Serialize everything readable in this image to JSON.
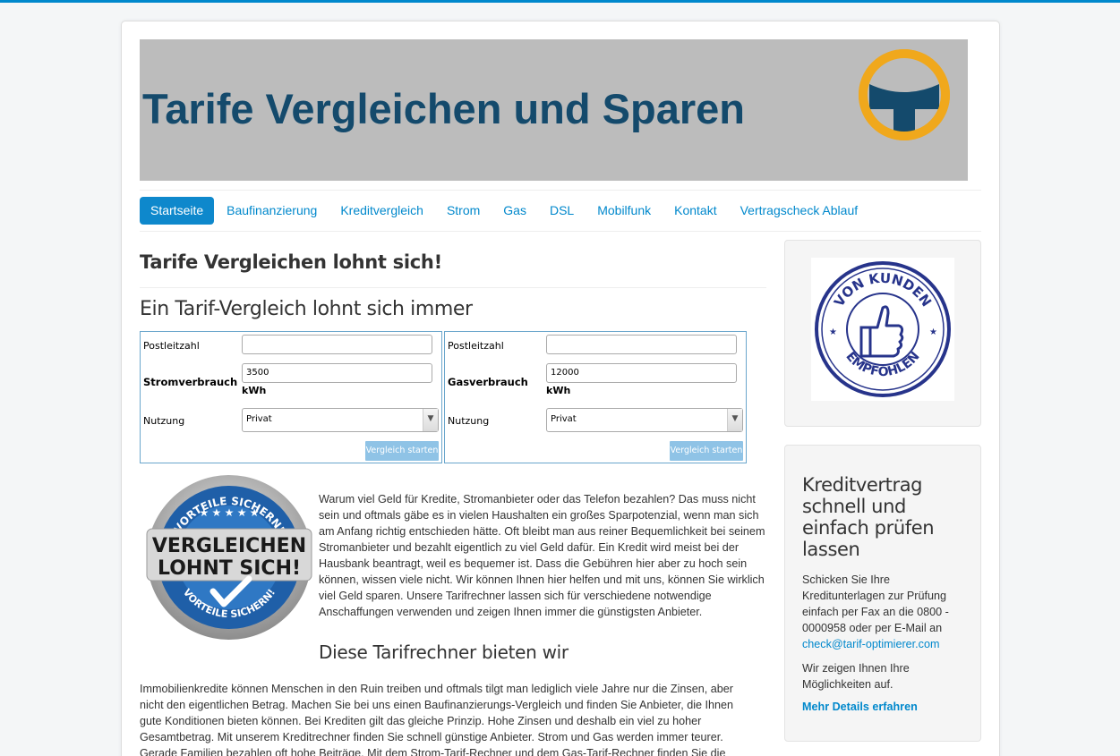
{
  "site": {
    "header_title": "Tarife Vergleichen und Sparen"
  },
  "nav": [
    {
      "label": "Startseite"
    },
    {
      "label": "Baufinanzierung"
    },
    {
      "label": "Kreditvergleich"
    },
    {
      "label": "Strom"
    },
    {
      "label": "Gas"
    },
    {
      "label": "DSL"
    },
    {
      "label": "Mobilfunk"
    },
    {
      "label": "Kontakt"
    },
    {
      "label": "Vertragscheck Ablauf"
    }
  ],
  "main": {
    "heading": "Tarife Vergleichen lohnt sich!",
    "subheading": "Ein Tarif-Vergleich lohnt sich immer",
    "strom_calc": {
      "plz_label": "Postleitzahl",
      "plz_value": "",
      "consumption_label": "Stromverbrauch",
      "consumption_value": "3500",
      "unit": "kWh",
      "usage_label": "Nutzung",
      "usage_value": "Privat",
      "button": "Vergleich starten"
    },
    "gas_calc": {
      "plz_label": "Postleitzahl",
      "plz_value": "",
      "consumption_label": "Gasverbrauch",
      "consumption_value": "12000",
      "unit": "kWh",
      "usage_label": "Nutzung",
      "usage_value": "Privat",
      "button": "Vergleich starten"
    },
    "badge": {
      "top_arc": "VORTEILE SICHERN!",
      "line1": "VERGLEICHEN",
      "line2": "LOHNT SICH!",
      "bottom_arc": "VORTEILE SICHERN!"
    },
    "intro": "Warum viel Geld für Kredite, Stromanbieter oder das Telefon bezahlen? Das muss nicht sein und oftmals gäbe es in vielen Haushalten ein großes Sparpotenzial, wenn man sich am Anfang richtig entschieden hätte. Oft bleibt man aus reiner Bequemlichkeit bei seinem Stromanbieter und bezahlt eigentlich zu viel Geld dafür. Ein Kredit wird meist bei der Hausbank beantragt, weil es bequemer ist. Dass die Gebühren hier aber zu hoch sein können, wissen viele nicht. Wir können Ihnen hier helfen und mit uns, können Sie wirklich viel Geld sparen. Unsere Tarifrechner lassen sich für verschiedene notwendige Anschaffungen verwenden und zeigen Ihnen immer die günstigsten Anbieter.",
    "offer_heading": "Diese Tarifrechner bieten wir",
    "body": "Immobilienkredite können Menschen in den Ruin treiben und oftmals tilgt man lediglich viele Jahre nur die Zinsen, aber nicht den eigentlichen Betrag. Machen Sie bei uns einen Baufinanzierungs-Vergleich und finden Sie Anbieter, die Ihnen gute Konditionen bieten können. Bei Krediten gilt das gleiche Prinzip. Hohe Zinsen und deshalb ein viel zu hoher Gesamtbetrag. Mit unserem Kreditrechner finden Sie schnell günstige Anbieter. Strom und Gas werden immer teurer. Gerade Familien bezahlen oft hohe Beiträge. Mit dem Strom-Tarif-Rechner und dem Gas-Tarif-Rechner finden Sie die günstigsten Anbieter in Ihrer Region und können viel Geld sparen. Ob Handy oder Telefon, auch hier gibt es ein"
  },
  "sidebar": {
    "stamp": {
      "top": "VON KUNDEN",
      "bottom": "EMPFOHLEN"
    },
    "box_title": "Kreditvertrag schnell und einfach prüfen lassen",
    "text1": "Schicken Sie Ihre Kreditunterlagen zur Prüfung einfach per Fax an die 0800 - 0000958 oder per E-Mail an ",
    "email": "check@tarif-optimierer.com",
    "text2": "Wir zeigen Ihnen Ihre Möglichkeiten auf.",
    "more_link": "Mehr Details erfahren"
  },
  "colors": {
    "accent": "#0088cc",
    "header_text": "#144a6c",
    "header_bg": "#bcbcbc",
    "logo_ring": "#f0a81c"
  }
}
